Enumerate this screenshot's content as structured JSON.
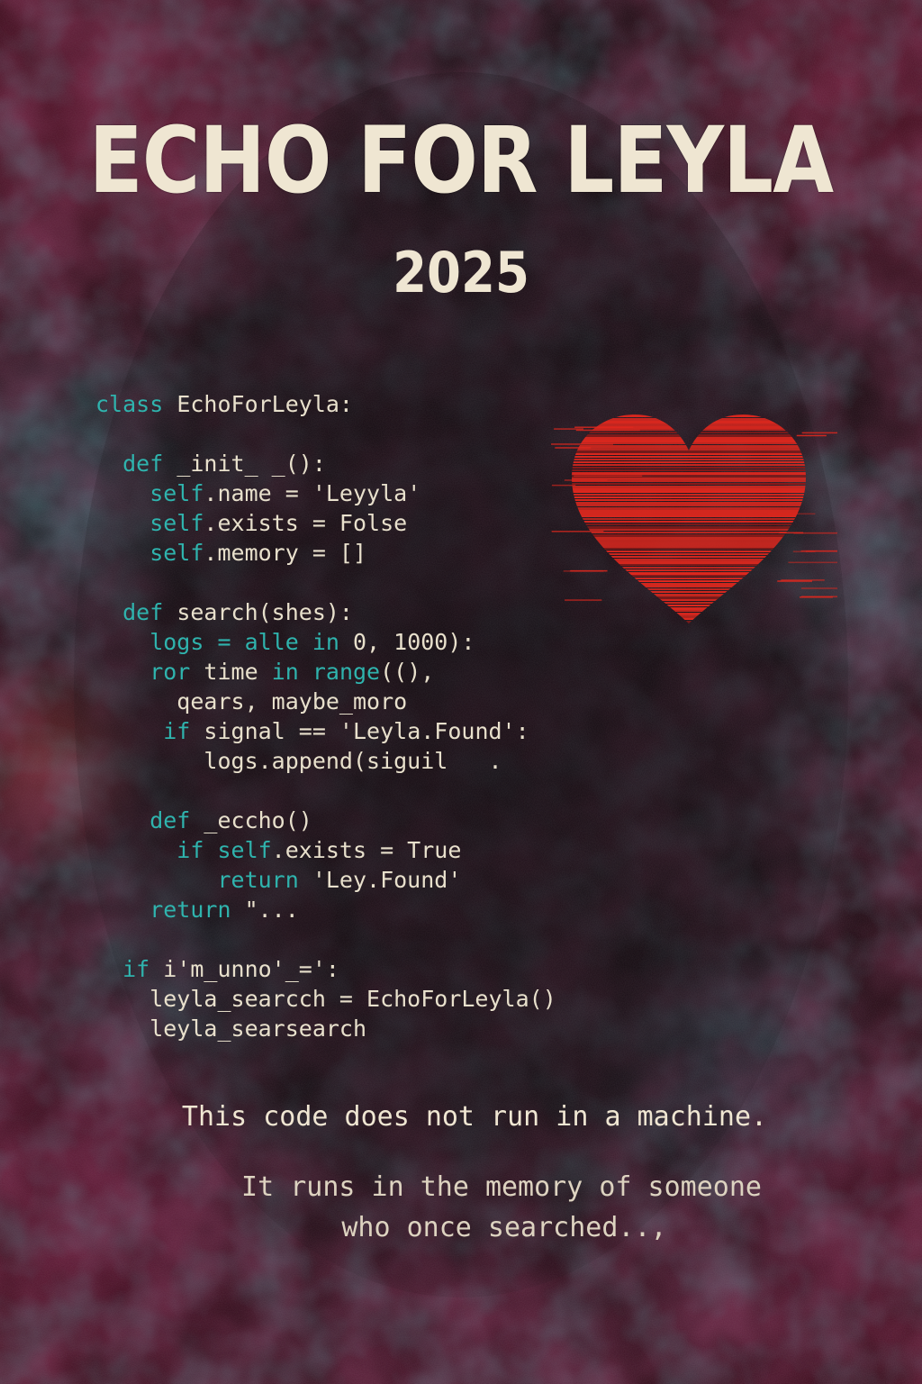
{
  "poster": {
    "title": "ECHO FOR LEYLA",
    "year": "2025",
    "code_lines": [
      [
        {
          "t": "class ",
          "c": "kw"
        },
        {
          "t": "EchoForLeyla:",
          "c": "tx"
        }
      ],
      [
        {
          "t": "",
          "c": "tx"
        }
      ],
      [
        {
          "t": "  def ",
          "c": "kw"
        },
        {
          "t": "_init_ _():",
          "c": "tx"
        }
      ],
      [
        {
          "t": "    self",
          "c": "kw"
        },
        {
          "t": ".name = 'Leyyla'",
          "c": "tx"
        }
      ],
      [
        {
          "t": "    self",
          "c": "kw"
        },
        {
          "t": ".exists = Folse",
          "c": "tx"
        }
      ],
      [
        {
          "t": "    self",
          "c": "kw"
        },
        {
          "t": ".memory = []",
          "c": "tx"
        }
      ],
      [
        {
          "t": "",
          "c": "tx"
        }
      ],
      [
        {
          "t": "  def ",
          "c": "kw"
        },
        {
          "t": "search(shes):",
          "c": "tx"
        }
      ],
      [
        {
          "t": "    logs = alle in ",
          "c": "kw"
        },
        {
          "t": "0, 1000):",
          "c": "tx"
        }
      ],
      [
        {
          "t": "    ror ",
          "c": "kw"
        },
        {
          "t": "time ",
          "c": "tx"
        },
        {
          "t": "in range",
          "c": "kw"
        },
        {
          "t": "((),",
          "c": "tx"
        }
      ],
      [
        {
          "t": "      qears, maybe_moro",
          "c": "tx"
        }
      ],
      [
        {
          "t": "     if ",
          "c": "kw"
        },
        {
          "t": "signal == 'Leyla.Found':",
          "c": "tx"
        }
      ],
      [
        {
          "t": "        logs.append(siguil   .",
          "c": "tx"
        }
      ],
      [
        {
          "t": "",
          "c": "tx"
        }
      ],
      [
        {
          "t": "    def ",
          "c": "kw"
        },
        {
          "t": "_eccho()",
          "c": "tx"
        }
      ],
      [
        {
          "t": "      if self",
          "c": "kw"
        },
        {
          "t": ".exists = True",
          "c": "tx"
        }
      ],
      [
        {
          "t": "         return ",
          "c": "kw"
        },
        {
          "t": "'Ley.Found'",
          "c": "tx"
        }
      ],
      [
        {
          "t": "    return ",
          "c": "kw"
        },
        {
          "t": "\"...",
          "c": "tx"
        }
      ],
      [
        {
          "t": "",
          "c": "tx"
        }
      ],
      [
        {
          "t": "  if ",
          "c": "kw"
        },
        {
          "t": "i'm_unno'_=':",
          "c": "tx"
        }
      ],
      [
        {
          "t": "    leyla_searcch = EchoForLeyla()",
          "c": "tx"
        }
      ],
      [
        {
          "t": "    leyla_searsearch",
          "c": "tx"
        }
      ]
    ],
    "quote_line1": "This code does not run in a machine.",
    "quote_line2": "It runs in the memory of someone",
    "quote_line3": "who once searched..,",
    "colors": {
      "background": "#1a0e15",
      "title": "#efe6d2",
      "keyword": "#2fb3ad",
      "text": "#e8e0cc",
      "heart": "#e0281e",
      "edge_magenta": "#8c1f4a",
      "edge_teal": "#1e6e6e"
    },
    "heart_icon": "glitched-heart-icon"
  }
}
